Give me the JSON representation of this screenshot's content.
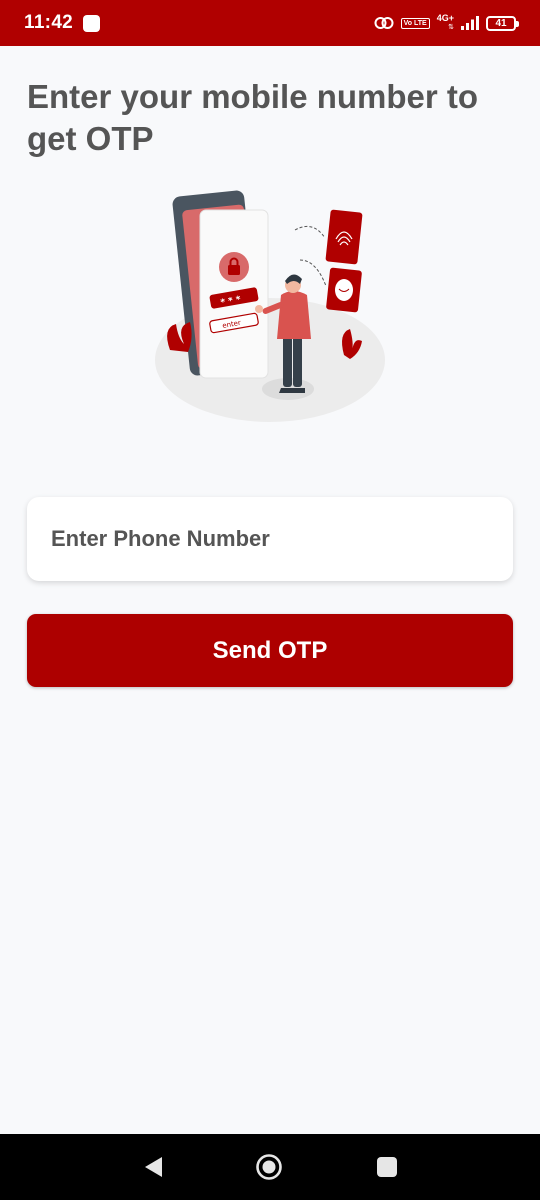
{
  "status_bar": {
    "time": "11:42",
    "volte": "Vo LTE",
    "network": "4G+",
    "battery": "41"
  },
  "heading": "Enter your mobile number to get OTP",
  "illustration": {
    "password_mask": "* * *",
    "button_text": "enter"
  },
  "phone_field": {
    "placeholder": "Enter Phone Number",
    "value": ""
  },
  "send_button": {
    "label": "Send OTP"
  },
  "colors": {
    "brand": "#b00000",
    "button": "#ad0000",
    "heading": "#555555",
    "background": "#f8f9fb"
  },
  "icons": {
    "nav_back": "back-triangle-icon",
    "nav_home": "home-circle-icon",
    "nav_recents": "recents-square-icon"
  }
}
